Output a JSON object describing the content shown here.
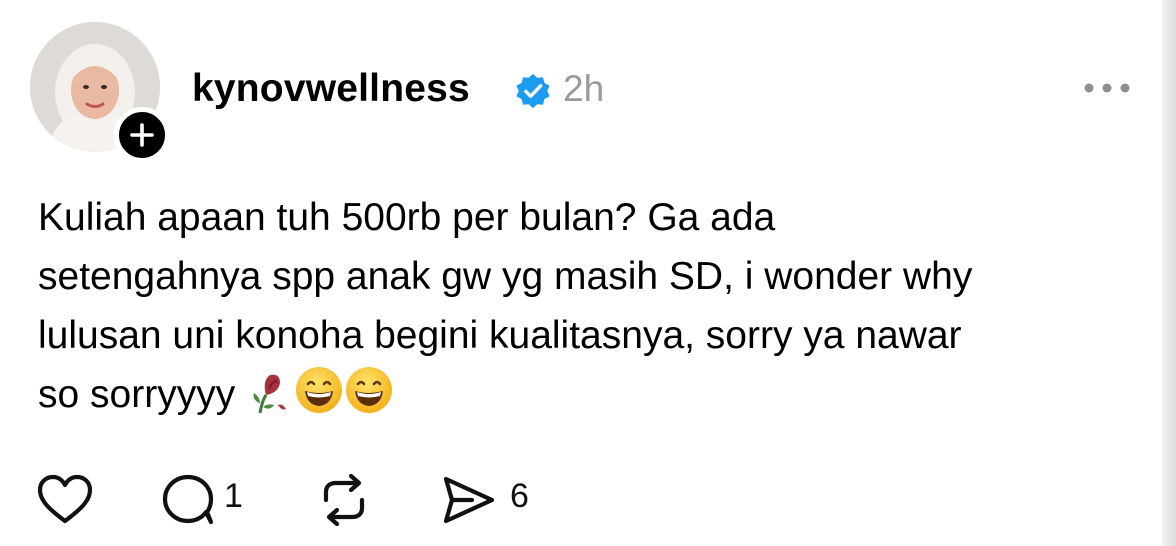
{
  "post": {
    "author": "kynovwellness",
    "verified": true,
    "time": "2h",
    "text": "Kuliah apaan tuh 500rb per bulan? Ga ada\nsetengahnya spp anak gw yg masih SD, i wonder why\nlulusan uni konoha begini kualitasnya, sorry ya nawar\nso sorryyyy ",
    "emojis": [
      "wilted-rose-emoji",
      "grinning-face-emoji",
      "grinning-face-emoji"
    ]
  },
  "actions": {
    "like_icon": "heart-icon",
    "reply_icon": "comment-icon",
    "reply_count": "1",
    "repost_icon": "repost-icon",
    "share_icon": "send-icon",
    "share_count": "6"
  },
  "colors": {
    "verified_blue": "#1d9bf0",
    "muted": "#9a9a9a"
  }
}
